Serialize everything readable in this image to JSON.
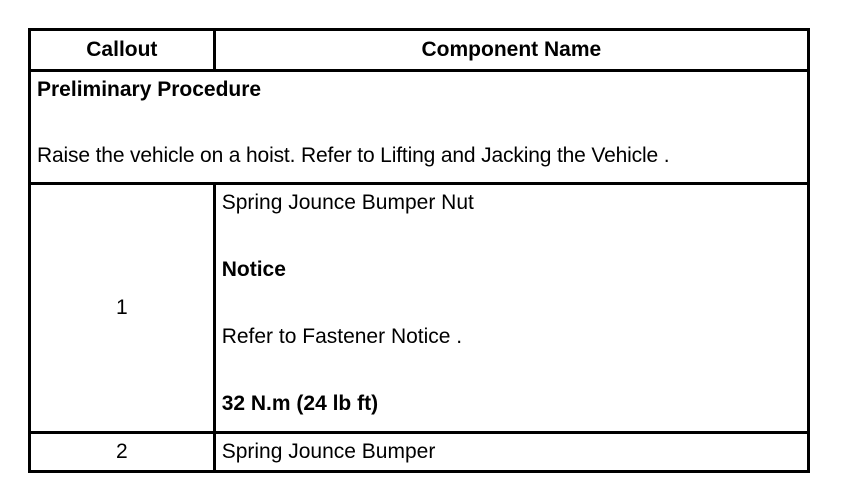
{
  "table": {
    "headers": {
      "callout": "Callout",
      "component_name": "Component Name"
    },
    "preliminary": {
      "title": "Preliminary Procedure",
      "text": "Raise the vehicle on a hoist. Refer to Lifting and Jacking the Vehicle ."
    },
    "rows": [
      {
        "callout": "1",
        "name": "Spring Jounce Bumper Nut",
        "notice_label": "Notice",
        "notice_text": "Refer to Fastener Notice .",
        "torque": "32 N.m (24 lb ft)"
      },
      {
        "callout": "2",
        "name": "Spring Jounce Bumper"
      }
    ]
  }
}
